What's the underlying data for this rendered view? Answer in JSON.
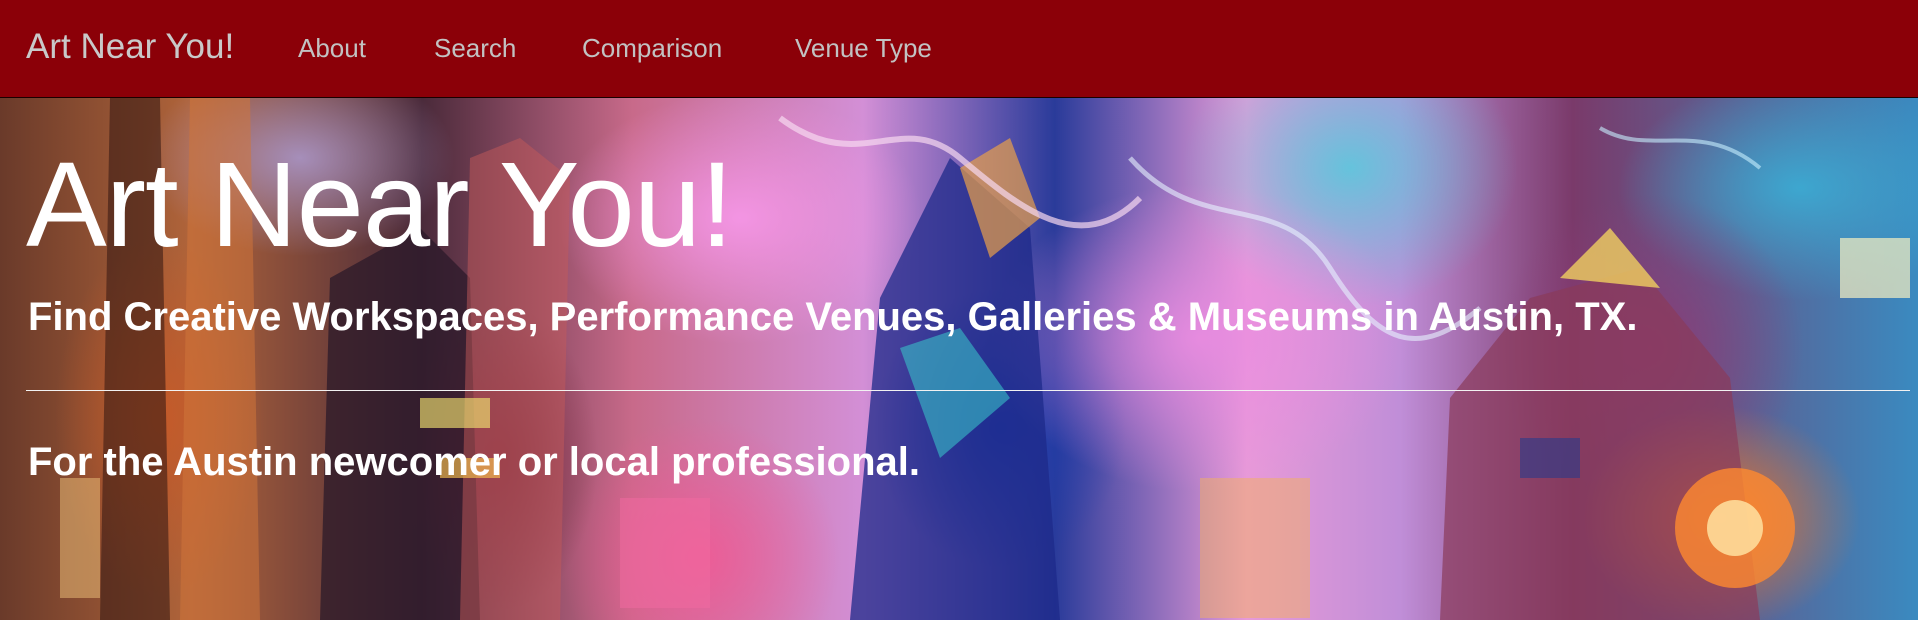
{
  "navbar": {
    "brand": "Art Near You!",
    "items": [
      {
        "label": "About"
      },
      {
        "label": "Search"
      },
      {
        "label": "Comparison"
      },
      {
        "label": "Venue Type"
      }
    ],
    "background": "#8b0008",
    "text_color": "#c2c2c2"
  },
  "hero": {
    "title": "Art Near You!",
    "subtitle": "Find Creative Workspaces, Performance Venues, Galleries & Museums in Austin, TX.",
    "tagline": "For the Austin newcomer or local professional.",
    "text_color": "#ffffff"
  }
}
